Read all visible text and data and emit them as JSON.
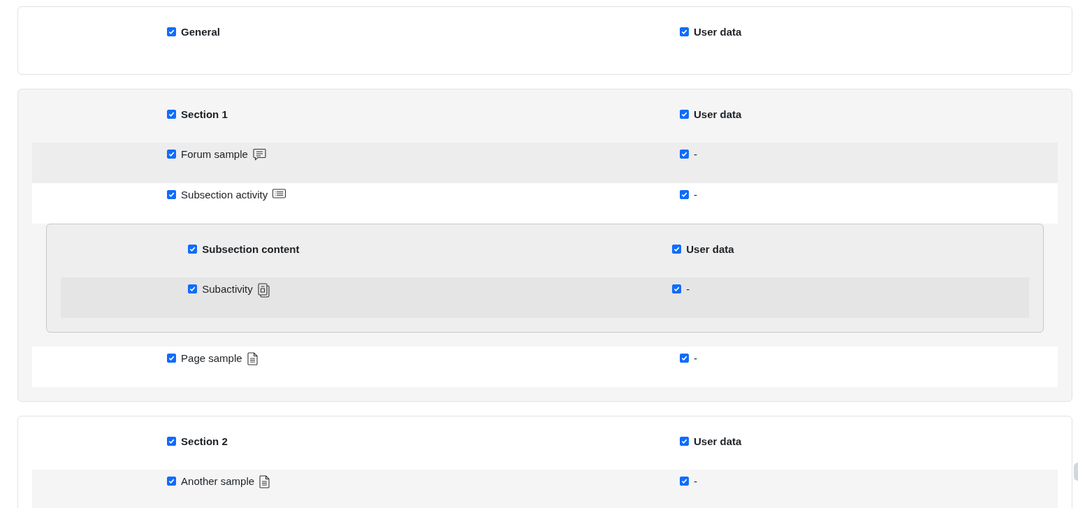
{
  "sections": [
    {
      "title": "General",
      "checked": true,
      "user_data": {
        "label": "User data",
        "checked": true
      }
    },
    {
      "title": "Section 1",
      "checked": true,
      "user_data": {
        "label": "User data",
        "checked": true
      },
      "items": [
        {
          "label": "Forum sample",
          "kind": "forum",
          "checked": true,
          "user_data": {
            "text": "-",
            "checked": true
          }
        },
        {
          "label": "Subsection activity",
          "kind": "subsection",
          "checked": true,
          "user_data": {
            "text": "-",
            "checked": true
          },
          "subsection": {
            "title": "Subsection content",
            "checked": true,
            "user_data": {
              "label": "User data",
              "checked": true
            },
            "items": [
              {
                "label": "Subactivity",
                "kind": "copies",
                "checked": true,
                "user_data": {
                  "text": "-",
                  "checked": true
                }
              }
            ]
          }
        },
        {
          "label": "Page sample",
          "kind": "page",
          "checked": true,
          "user_data": {
            "text": "-",
            "checked": true
          }
        }
      ]
    },
    {
      "title": "Section 2",
      "checked": true,
      "user_data": {
        "label": "User data",
        "checked": true
      },
      "items": [
        {
          "label": "Another sample",
          "kind": "page",
          "checked": true,
          "user_data": {
            "text": "-",
            "checked": true
          }
        }
      ]
    }
  ]
}
